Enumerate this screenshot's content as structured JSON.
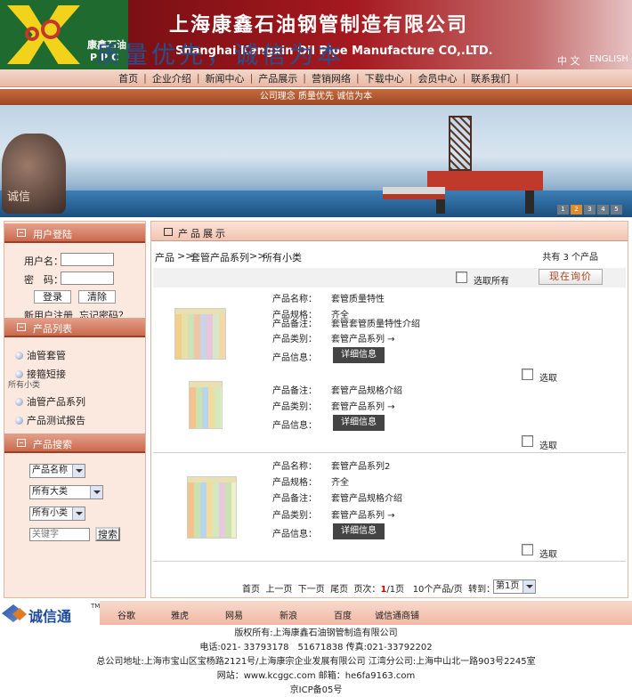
{
  "header": {
    "logo_cn": "康鑫石油",
    "logo_en": "PPC",
    "company_cn": "上海康鑫石油钢管制造有限公司",
    "company_en": "Shanghai Kangxin Oil Pipe Manufacture CO,.LTD.",
    "lang_cn": "中 文",
    "lang_en": "ENGLISH"
  },
  "nav": {
    "items": [
      "首页",
      "企业介绍",
      "新闻中心",
      "产品展示",
      "营销网络",
      "下载中心",
      "会员中心",
      "联系我们"
    ]
  },
  "slogan_bar": "公司理念 质量优先 诚信为本",
  "hero": {
    "slogan": "质量优先，诚信为本",
    "globe_text": "诚信",
    "pager": [
      "1",
      "2",
      "3",
      "4",
      "5"
    ],
    "active_page": "2"
  },
  "sidebar": {
    "login": {
      "title": "用户登陆",
      "username_label": "用户名：",
      "password_label": "密　码：",
      "login_button": "登录",
      "clear_button": "清除",
      "register_link": "新用户注册",
      "forgot_link": "忘记密码？"
    },
    "product_list": {
      "title": "产品列表",
      "items": [
        "油管套管",
        "接箍短接",
        "油管产品系列",
        "产品测试报告"
      ],
      "overlap_text": "所有小类"
    },
    "product_search": {
      "title": "产品搜索",
      "field_select": "产品名称",
      "category_select": "所有大类",
      "subcategory_select": "所有小类",
      "keyword_placeholder": "关键字",
      "search_button": "搜索"
    }
  },
  "main": {
    "title": "产品展示",
    "breadcrumb": [
      "产品",
      ">>",
      "套管产品系列",
      ">>",
      "所有小类"
    ],
    "total": "共有 3 个产品",
    "select_all": "选取所有",
    "inquiry_button": "现在询价",
    "select_label": "选取",
    "detail_button": "详细信息",
    "products": [
      {
        "name_label": "产品名称：",
        "name": "套管质量特性",
        "spec_label": "产品规格：",
        "spec": "齐全",
        "note_label": "产品备注：",
        "note": "套管套管质量特性介绍",
        "category_label": "产品类别：",
        "category": "套管产品系列 →",
        "info_label": "产品信息："
      },
      {
        "note_label": "产品备注：",
        "note": "套管产品规格介绍",
        "category_label": "产品类别：",
        "category": "套管产品系列 →",
        "info_label": "产品信息："
      },
      {
        "name_label": "产品名称：",
        "name": "套管产品系列2",
        "spec_label": "产品规格：",
        "spec": "齐全",
        "note_label": "产品备注：",
        "note": "套管产品规格介绍",
        "category_label": "产品类别：",
        "category": "套管产品系列 →",
        "info_label": "产品信息："
      }
    ],
    "pagination": {
      "first": "首页",
      "prev": "上一页",
      "next": "下一页",
      "last": "尾页",
      "page_label": "页次：",
      "page_current": "1",
      "page_total": "/1页",
      "per_page": "10个产品/页",
      "goto": "转到：",
      "goto_select": "第1页"
    }
  },
  "links": {
    "brand": "诚信通",
    "brand_tm": "TM",
    "items": [
      "谷歌",
      "雅虎",
      "网易",
      "新浪",
      "百度",
      "诚信通商铺"
    ]
  },
  "footer": {
    "copyright": "版权所有:上海康鑫石油钢管制造有限公司",
    "phone": "电话:021- 33793178　51671838 传真:021-33792202",
    "address": "总公司地址:上海市宝山区宝杨路2121号/上海康宗企业发展有限公司 江湾分公司:上海中山北一路903号2245室",
    "web": "网站：www.kcggc.com 邮箱：he6fa9163.com",
    "icp": "京ICP备05号"
  }
}
